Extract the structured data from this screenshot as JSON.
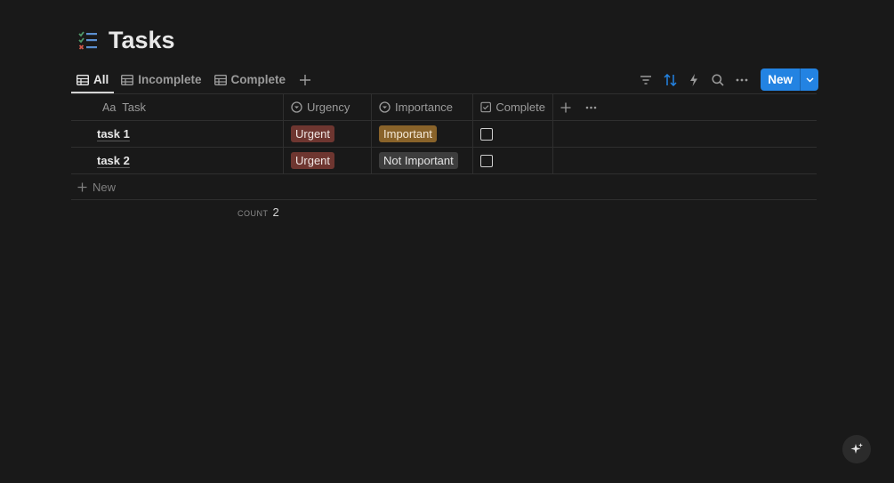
{
  "page": {
    "title": "Tasks",
    "icon": "checklist-icon"
  },
  "views": {
    "tabs": [
      {
        "label": "All",
        "icon": "table-icon",
        "active": true
      },
      {
        "label": "Incomplete",
        "icon": "table-icon",
        "active": false
      },
      {
        "label": "Complete",
        "icon": "table-icon",
        "active": false
      }
    ],
    "add_view_icon": "plus-icon"
  },
  "toolbar": {
    "icons": [
      "filter-icon",
      "sort-icon",
      "automation-icon",
      "search-icon",
      "more-icon"
    ],
    "new_label": "New",
    "accent": "#2383e2"
  },
  "table": {
    "columns": [
      {
        "label": "Task",
        "icon": "Aa"
      },
      {
        "label": "Urgency",
        "icon": "select-icon"
      },
      {
        "label": "Importance",
        "icon": "select-icon"
      },
      {
        "label": "Complete",
        "icon": "checkbox-icon"
      }
    ],
    "rows": [
      {
        "task": "task 1",
        "urgency": "Urgent",
        "importance": "Important",
        "complete": false
      },
      {
        "task": "task 2",
        "urgency": "Urgent",
        "importance": "Not Important",
        "complete": false
      }
    ],
    "new_row_label": "New",
    "count_label": "COUNT",
    "count_value": "2"
  },
  "colors": {
    "urgent": "#6e3630",
    "important": "#89632a",
    "not_important": "#3d3d3d"
  }
}
